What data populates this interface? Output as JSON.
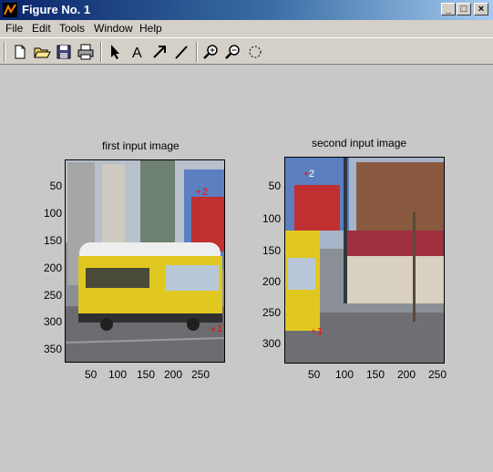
{
  "window": {
    "title": "Figure No. 1"
  },
  "menu": [
    "File",
    "Edit",
    "Tools",
    "Window",
    "Help"
  ],
  "toolbar_icons": [
    "new-file-icon",
    "open-folder-icon",
    "save-icon",
    "print-icon",
    "arrow-pointer-icon",
    "text-A-icon",
    "arrow-icon",
    "line-icon",
    "zoom-in-icon",
    "zoom-out-icon",
    "rotate-icon"
  ],
  "plots": [
    {
      "title": "first input image",
      "yticks": [
        "50",
        "100",
        "150",
        "200",
        "250",
        "300",
        "350"
      ],
      "xticks": [
        "50",
        "100",
        "150",
        "200",
        "250"
      ],
      "markers": [
        "1",
        "2"
      ]
    },
    {
      "title": "second input image",
      "yticks": [
        "50",
        "100",
        "150",
        "200",
        "250",
        "300"
      ],
      "xticks": [
        "50",
        "100",
        "150",
        "200",
        "250"
      ],
      "markers": [
        "2",
        "1"
      ]
    }
  ],
  "colors": {
    "titlebar": "#0a246a",
    "face": "#d4d0c8",
    "figure_bg": "#c8c8c8",
    "marker": "#ff0000"
  }
}
